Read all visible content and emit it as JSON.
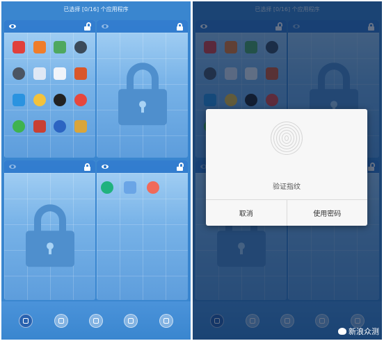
{
  "status_text": "已选择 [0/16] 个应用程序",
  "dialog": {
    "title": "验证指纹",
    "cancel": "取消",
    "use_password": "使用密码"
  },
  "watermark": "新浪众测",
  "colors": {
    "accent": "#3a86cf",
    "panel_light": "#a9d3f5",
    "overlay": "#081c3c",
    "dialog_bg": "#f7f7f7"
  }
}
